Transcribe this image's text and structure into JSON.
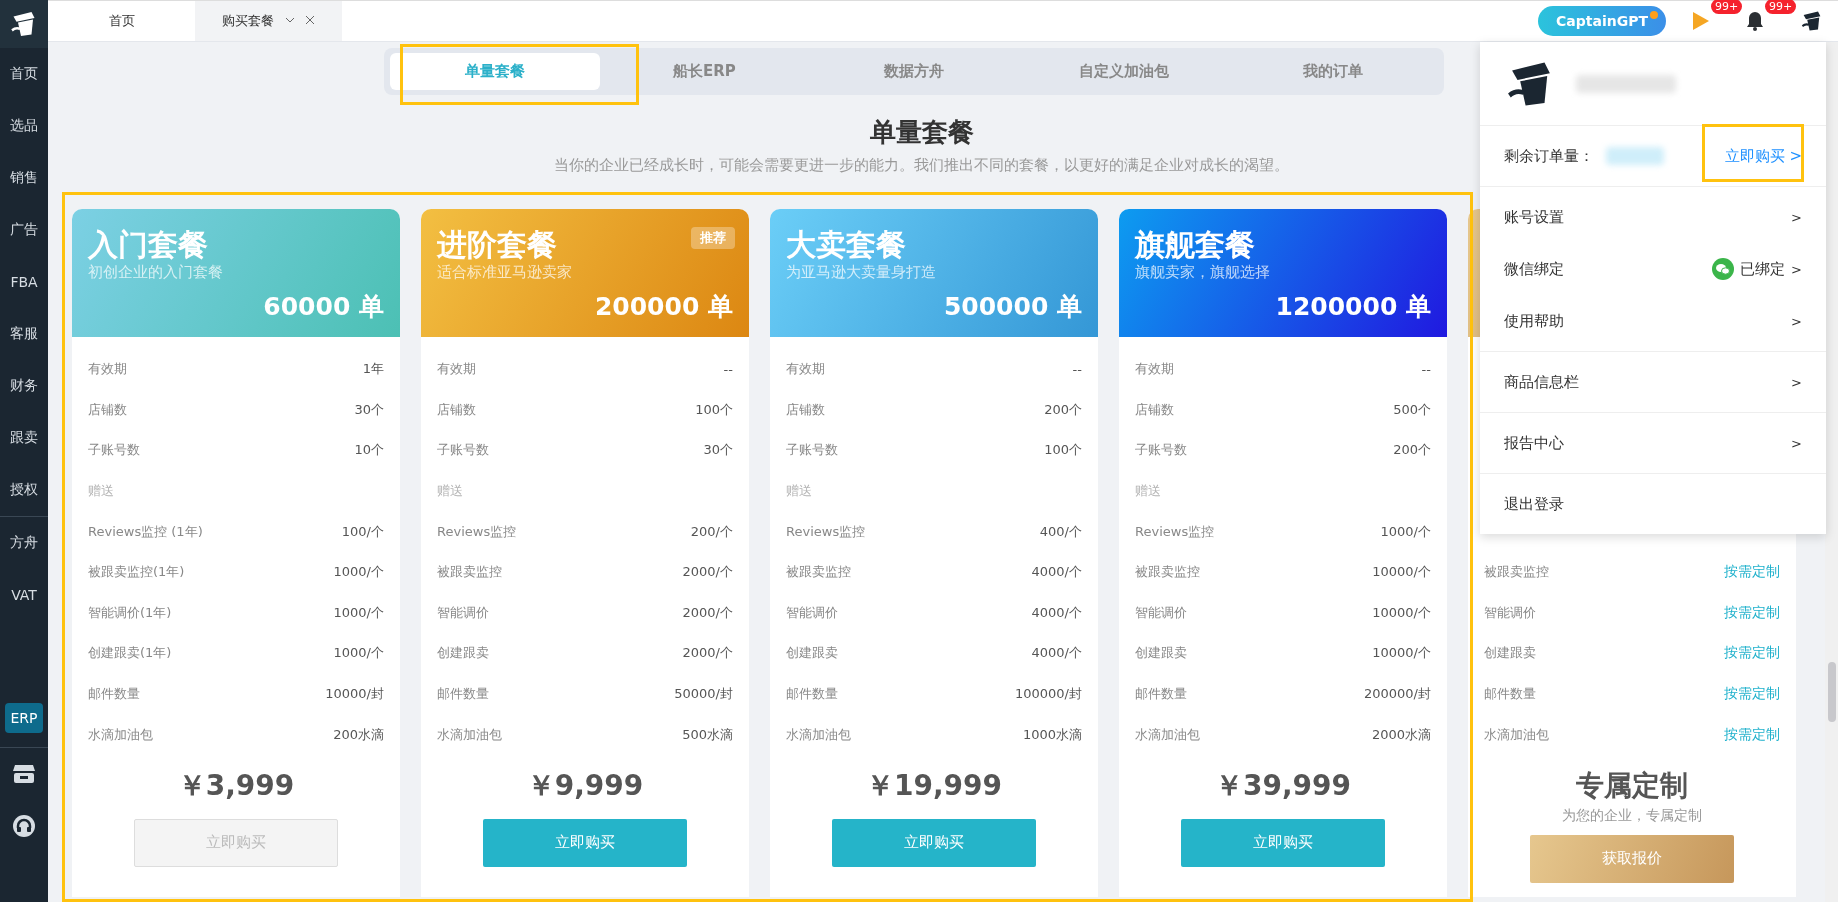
{
  "sidebar": {
    "sections": [
      [
        {
          "label": "首页",
          "kind": "text"
        },
        {
          "label": "选品",
          "kind": "text"
        },
        {
          "label": "销售",
          "kind": "text"
        },
        {
          "label": "广告",
          "kind": "text"
        },
        {
          "label": "FBA",
          "kind": "text"
        },
        {
          "label": "客服",
          "kind": "text"
        },
        {
          "label": "财务",
          "kind": "text"
        },
        {
          "label": "跟卖",
          "kind": "text"
        },
        {
          "label": "授权",
          "kind": "text"
        }
      ],
      [
        {
          "label": "方舟",
          "kind": "text"
        },
        {
          "label": "VAT",
          "kind": "text"
        },
        {
          "label": "ERP",
          "kind": "badge"
        }
      ],
      [
        {
          "kind": "store"
        },
        {
          "kind": "support"
        }
      ]
    ]
  },
  "tabs": [
    {
      "label": "首页",
      "selected": false,
      "closable": false
    },
    {
      "label": "购买套餐",
      "selected": true,
      "closable": true
    }
  ],
  "header": {
    "assistant_button": "CaptainGPT",
    "notices": [
      {
        "kind": "flag",
        "badge": "99+"
      },
      {
        "kind": "bell",
        "badge": "99+"
      }
    ]
  },
  "plan_tabs": [
    {
      "label": "单量套餐",
      "selected": true
    },
    {
      "label": "船长ERP",
      "selected": false
    },
    {
      "label": "数据方舟",
      "selected": false
    },
    {
      "label": "自定义加油包",
      "selected": false
    },
    {
      "label": "我的订单",
      "selected": false
    }
  ],
  "title": "单量套餐",
  "subtitle": "当你的企业已经成长时，可能会需要更进一步的能力。我们推出不同的套餐，以更好的满足企业对成长的渴望。",
  "plans": [
    {
      "kind": "teal",
      "name": "入门套餐",
      "tagline": "初创企业的入门套餐",
      "quota": "60000 单",
      "features": [
        {
          "kind": "row",
          "label": "有效期",
          "value": "1年"
        },
        {
          "kind": "row",
          "label": "店铺数",
          "value": "30个"
        },
        {
          "kind": "row",
          "label": "子账号数",
          "value": "10个"
        },
        {
          "kind": "section",
          "label": "赠送"
        },
        {
          "kind": "row",
          "label": "Reviews监控 (1年)",
          "value": "100/个"
        },
        {
          "kind": "row",
          "label": "被跟卖监控(1年)",
          "value": "1000/个"
        },
        {
          "kind": "row",
          "label": "智能调价(1年)",
          "value": "1000/个"
        },
        {
          "kind": "row",
          "label": "创建跟卖(1年)",
          "value": "1000/个"
        },
        {
          "kind": "row",
          "label": "邮件数量",
          "value": "10000/封"
        },
        {
          "kind": "row",
          "label": "水滴加油包",
          "value": "200水滴"
        }
      ],
      "price": "￥3,999",
      "button": {
        "label": "立即购买",
        "disabled": true
      }
    },
    {
      "kind": "gold",
      "name": "进阶套餐",
      "tagline": "适合标准亚马逊卖家",
      "quota": "200000 单",
      "badge": "推荐",
      "features": [
        {
          "kind": "row",
          "label": "有效期",
          "value": "--"
        },
        {
          "kind": "row",
          "label": "店铺数",
          "value": "100个"
        },
        {
          "kind": "row",
          "label": "子账号数",
          "value": "30个"
        },
        {
          "kind": "section",
          "label": "赠送"
        },
        {
          "kind": "row",
          "label": "Reviews监控",
          "value": "200/个"
        },
        {
          "kind": "row",
          "label": "被跟卖监控",
          "value": "2000/个"
        },
        {
          "kind": "row",
          "label": "智能调价",
          "value": "2000/个"
        },
        {
          "kind": "row",
          "label": "创建跟卖",
          "value": "2000/个"
        },
        {
          "kind": "row",
          "label": "邮件数量",
          "value": "50000/封"
        },
        {
          "kind": "row",
          "label": "水滴加油包",
          "value": "500水滴"
        }
      ],
      "price": "￥9,999",
      "button": {
        "label": "立即购买",
        "disabled": false
      }
    },
    {
      "kind": "sky",
      "name": "大卖套餐",
      "tagline": "为亚马逊大卖量身打造",
      "quota": "500000 单",
      "features": [
        {
          "kind": "row",
          "label": "有效期",
          "value": "--"
        },
        {
          "kind": "row",
          "label": "店铺数",
          "value": "200个"
        },
        {
          "kind": "row",
          "label": "子账号数",
          "value": "100个"
        },
        {
          "kind": "section",
          "label": "赠送"
        },
        {
          "kind": "row",
          "label": "Reviews监控",
          "value": "400/个"
        },
        {
          "kind": "row",
          "label": "被跟卖监控",
          "value": "4000/个"
        },
        {
          "kind": "row",
          "label": "智能调价",
          "value": "4000/个"
        },
        {
          "kind": "row",
          "label": "创建跟卖",
          "value": "4000/个"
        },
        {
          "kind": "row",
          "label": "邮件数量",
          "value": "100000/封"
        },
        {
          "kind": "row",
          "label": "水滴加油包",
          "value": "1000水滴"
        }
      ],
      "price": "￥19,999",
      "button": {
        "label": "立即购买",
        "disabled": false
      }
    },
    {
      "kind": "blue",
      "name": "旗舰套餐",
      "tagline": "旗舰卖家，旗舰选择",
      "quota": "1200000 单",
      "features": [
        {
          "kind": "row",
          "label": "有效期",
          "value": "--"
        },
        {
          "kind": "row",
          "label": "店铺数",
          "value": "500个"
        },
        {
          "kind": "row",
          "label": "子账号数",
          "value": "200个"
        },
        {
          "kind": "section",
          "label": "赠送"
        },
        {
          "kind": "row",
          "label": "Reviews监控",
          "value": "1000/个"
        },
        {
          "kind": "row",
          "label": "被跟卖监控",
          "value": "10000/个"
        },
        {
          "kind": "row",
          "label": "智能调价",
          "value": "10000/个"
        },
        {
          "kind": "row",
          "label": "创建跟卖",
          "value": "10000/个"
        },
        {
          "kind": "row",
          "label": "邮件数量",
          "value": "200000/封"
        },
        {
          "kind": "row",
          "label": "水滴加油包",
          "value": "2000水滴"
        }
      ],
      "price": "￥39,999",
      "button": {
        "label": "立即购买",
        "disabled": false
      }
    },
    {
      "kind": "custom",
      "features": [
        {
          "kind": "link",
          "label": "被跟卖监控",
          "value": "按需定制"
        },
        {
          "kind": "link",
          "label": "智能调价",
          "value": "按需定制"
        },
        {
          "kind": "link",
          "label": "创建跟卖",
          "value": "按需定制"
        },
        {
          "kind": "link",
          "label": "邮件数量",
          "value": "按需定制"
        },
        {
          "kind": "link",
          "label": "水滴加油包",
          "value": "按需定制"
        }
      ],
      "price": "专属定制",
      "price_note": "为您的企业，专属定制",
      "button": {
        "label": "获取报价",
        "disabled": false
      }
    }
  ],
  "account_menu": {
    "remaining_label": "剩余订单量：",
    "buy_link": "立即购买 >",
    "groups": [
      [
        {
          "label": "账号设置",
          "arrow": ">"
        },
        {
          "label": "微信绑定",
          "status": "已绑定",
          "arrow": ">"
        },
        {
          "label": "使用帮助",
          "arrow": ">"
        }
      ],
      [
        {
          "label": "商品信息栏",
          "arrow": ">"
        }
      ],
      [
        {
          "label": "报告中心",
          "arrow": ">"
        }
      ],
      [
        {
          "label": "退出登录"
        }
      ]
    ]
  }
}
